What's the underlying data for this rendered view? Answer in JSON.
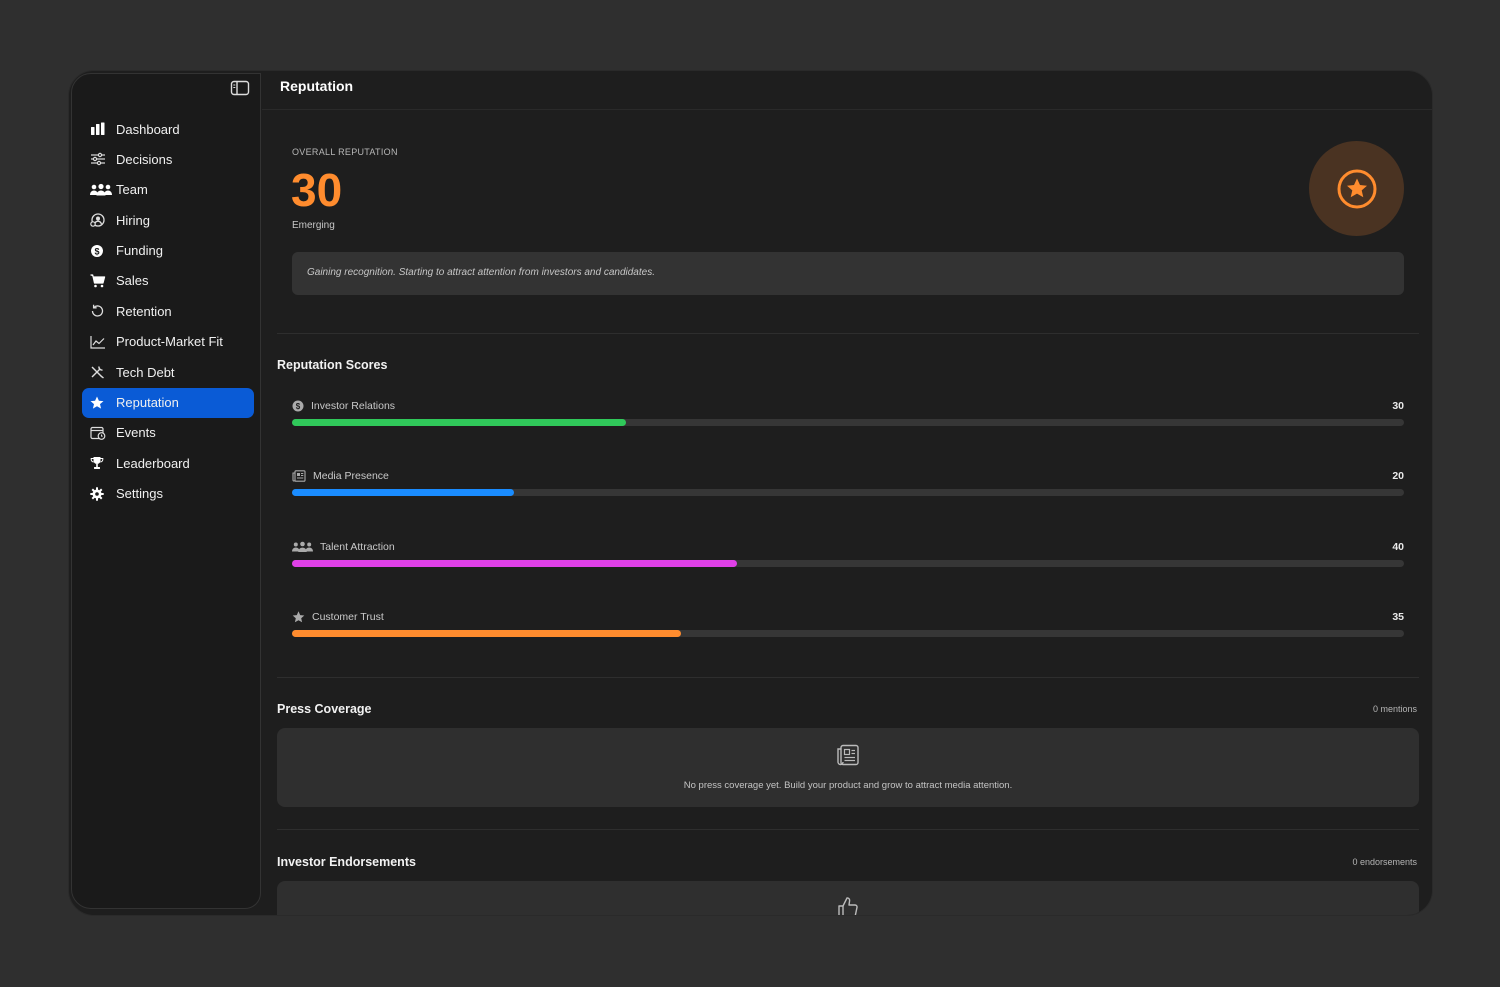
{
  "sidebar": {
    "items": [
      {
        "label": "Dashboard",
        "icon": "bar-chart-icon"
      },
      {
        "label": "Decisions",
        "icon": "sliders-icon"
      },
      {
        "label": "Team",
        "icon": "people-icon"
      },
      {
        "label": "Hiring",
        "icon": "person-search-icon"
      },
      {
        "label": "Funding",
        "icon": "dollar-icon"
      },
      {
        "label": "Sales",
        "icon": "cart-icon"
      },
      {
        "label": "Retention",
        "icon": "refresh-icon"
      },
      {
        "label": "Product-Market Fit",
        "icon": "line-chart-icon"
      },
      {
        "label": "Tech Debt",
        "icon": "tools-icon"
      },
      {
        "label": "Reputation",
        "icon": "star-icon"
      },
      {
        "label": "Events",
        "icon": "calendar-clock-icon"
      },
      {
        "label": "Leaderboard",
        "icon": "trophy-icon"
      },
      {
        "label": "Settings",
        "icon": "gear-icon"
      }
    ],
    "active": "Reputation"
  },
  "header": {
    "title": "Reputation"
  },
  "overall": {
    "label": "OVERALL REPUTATION",
    "value": "30",
    "tier": "Emerging",
    "description": "Gaining recognition. Starting to attract attention from investors and candidates."
  },
  "scores": {
    "title": "Reputation Scores",
    "items": [
      {
        "label": "Investor Relations",
        "value": "30",
        "percent": 30,
        "color": "#30c85a",
        "icon": "dollar-icon"
      },
      {
        "label": "Media Presence",
        "value": "20",
        "percent": 20,
        "color": "#1a8cff",
        "icon": "newspaper-icon"
      },
      {
        "label": "Talent Attraction",
        "value": "40",
        "percent": 40,
        "color": "#e040e8",
        "icon": "people-icon"
      },
      {
        "label": "Customer Trust",
        "value": "35",
        "percent": 35,
        "color": "#ff8c2e",
        "icon": "star-icon"
      }
    ]
  },
  "press": {
    "title": "Press Coverage",
    "count": "0 mentions",
    "empty": "No press coverage yet. Build your product and grow to attract media attention."
  },
  "endorsements": {
    "title": "Investor Endorsements",
    "count": "0 endorsements"
  },
  "colors": {
    "accent": "#ff8c2e",
    "active": "#0a5bd6"
  }
}
